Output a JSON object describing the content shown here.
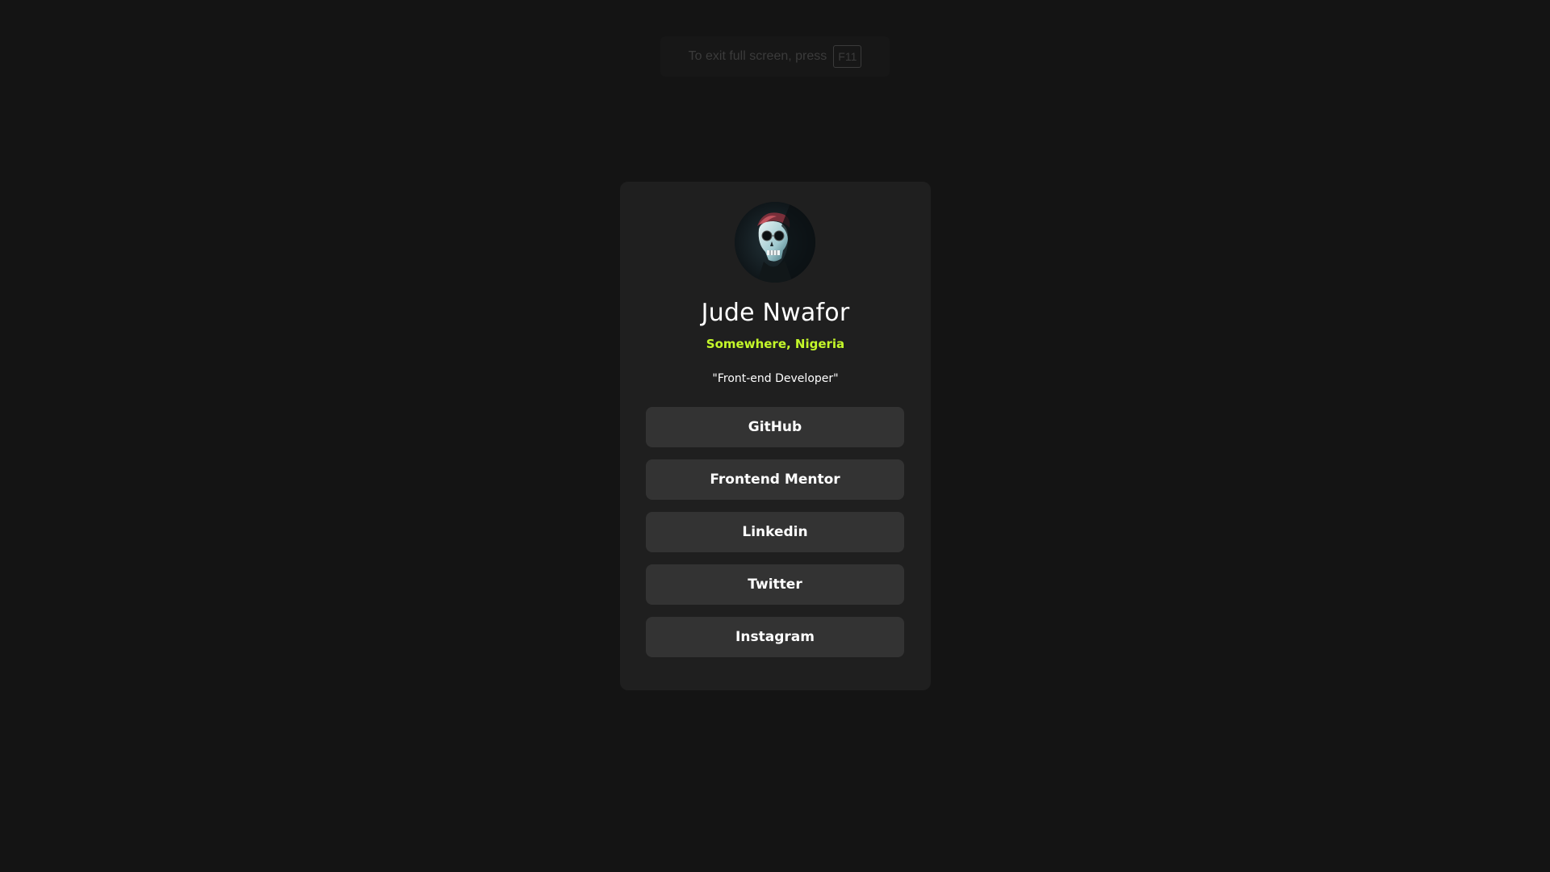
{
  "fullscreen_hint": {
    "text": "To exit full screen, press",
    "key": "F11"
  },
  "profile": {
    "avatar_icon": "skull-portrait-avatar",
    "name": "Jude Nwafor",
    "location": "Somewhere, Nigeria",
    "bio": "\"Front-end Developer\""
  },
  "links": [
    {
      "label": "GitHub"
    },
    {
      "label": "Frontend Mentor"
    },
    {
      "label": "Linkedin"
    },
    {
      "label": "Twitter"
    },
    {
      "label": "Instagram"
    }
  ],
  "colors": {
    "page_background": "#141414",
    "card_background": "#1f1f1f",
    "button_background": "#333333",
    "accent": "#c4f82a"
  }
}
